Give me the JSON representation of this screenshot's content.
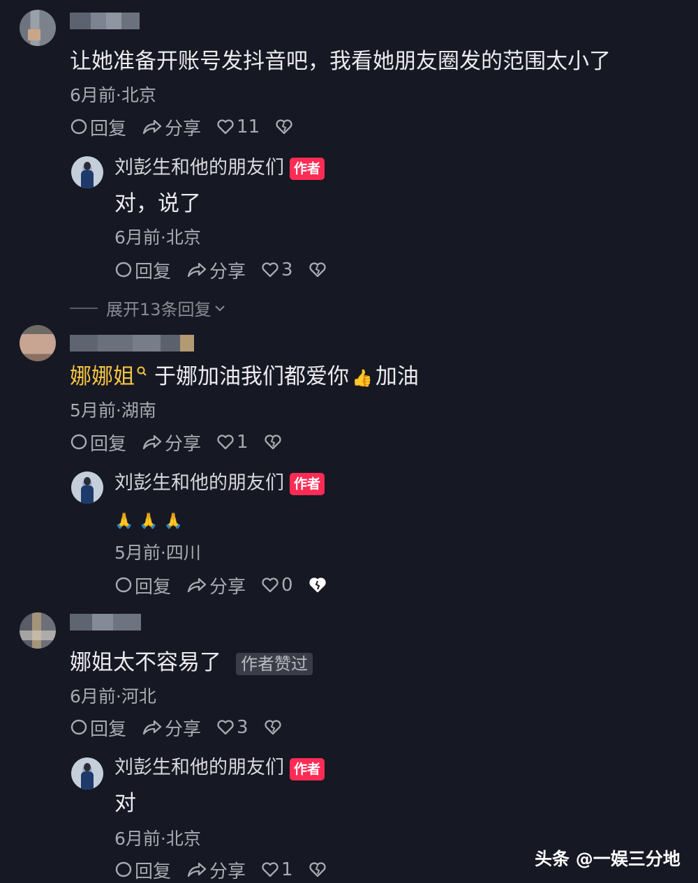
{
  "comments": [
    {
      "text": "让她准备开账号发抖音吧，我看她朋友圈发的范围太小了",
      "meta": "6月前·北京",
      "reply_label": "回复",
      "share_label": "分享",
      "likes": "11",
      "reply": {
        "author": "刘彭生和他的朋友们",
        "badge": "作者",
        "text": "对，说了",
        "meta": "6月前·北京",
        "reply_label": "回复",
        "share_label": "分享",
        "likes": "3"
      },
      "expand_label": "展开13条回复"
    },
    {
      "mention": "娜娜姐",
      "text": "于娜加油我们都爱你",
      "text_tail": "加油",
      "meta": "5月前·湖南",
      "reply_label": "回复",
      "share_label": "分享",
      "likes": "1",
      "reply": {
        "author": "刘彭生和他的朋友们",
        "badge": "作者",
        "text": "🙏🙏🙏",
        "meta": "5月前·四川",
        "reply_label": "回复",
        "share_label": "分享",
        "likes": "0"
      }
    },
    {
      "text": "娜姐太不容易了",
      "liked_tag": "作者赞过",
      "meta": "6月前·河北",
      "reply_label": "回复",
      "share_label": "分享",
      "likes": "3",
      "reply": {
        "author": "刘彭生和他的朋友们",
        "badge": "作者",
        "text": "对",
        "meta": "6月前·北京",
        "reply_label": "回复",
        "share_label": "分享",
        "likes": "1"
      }
    }
  ],
  "watermark": "头条 @一娱三分地",
  "colors": {
    "background": "#161823",
    "badge": "#fe2c55",
    "mention": "#f5c443"
  }
}
